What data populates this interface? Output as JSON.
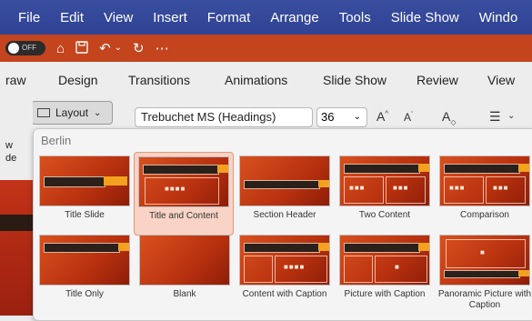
{
  "menubar": [
    "File",
    "Edit",
    "View",
    "Insert",
    "Format",
    "Arrange",
    "Tools",
    "Slide Show",
    "Windo"
  ],
  "qat": {
    "autosave_label": "OFF"
  },
  "ribbon_tabs": [
    "raw",
    "Design",
    "Transitions",
    "Animations",
    "Slide Show",
    "Review",
    "View"
  ],
  "ribbon": {
    "layout_label": "Layout",
    "font_name": "Trebuchet MS (Headings)",
    "font_size": "36",
    "left_labels": [
      "w",
      "de"
    ]
  },
  "layout_panel": {
    "theme_name": "Berlin",
    "layouts": [
      {
        "name": "Title Slide",
        "selected": false
      },
      {
        "name": "Title and Content",
        "selected": true
      },
      {
        "name": "Section Header",
        "selected": false
      },
      {
        "name": "Two Content",
        "selected": false
      },
      {
        "name": "Comparison",
        "selected": false
      },
      {
        "name": "Title Only",
        "selected": false
      },
      {
        "name": "Blank",
        "selected": false
      },
      {
        "name": "Content with Caption",
        "selected": false
      },
      {
        "name": "Picture with Caption",
        "selected": false
      },
      {
        "name": "Panoramic Picture with Caption",
        "selected": false
      }
    ]
  },
  "theme_colors": {
    "accent": "#f3a11f",
    "background": "#c4441e",
    "menubar": "#2f4294"
  }
}
